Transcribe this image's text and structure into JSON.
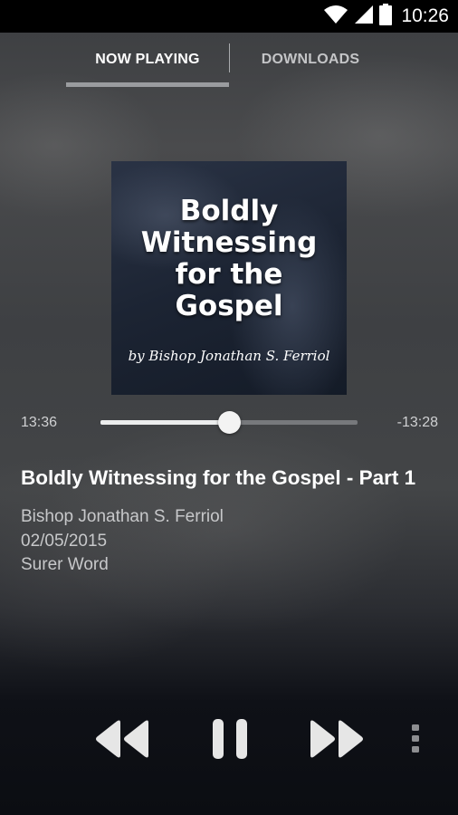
{
  "status_bar": {
    "time": "10:26",
    "icons": [
      "wifi-icon",
      "signal-icon",
      "battery-icon"
    ]
  },
  "tabs": [
    {
      "label": "NOW PLAYING",
      "active": true
    },
    {
      "label": "DOWNLOADS",
      "active": false
    }
  ],
  "artwork": {
    "title": "Boldly\nWitnessing\nfor the\nGospel",
    "author": "by Bishop Jonathan S. Ferriol"
  },
  "player": {
    "elapsed": "13:36",
    "remaining": "-13:28",
    "progress": 0.5
  },
  "track": {
    "title": "Boldly Witnessing for the Gospel - Part 1",
    "speaker": "Bishop Jonathan S. Ferriol",
    "date": "02/05/2015",
    "series": "Surer Word"
  },
  "controls": [
    "rewind-icon",
    "pause-icon",
    "fast-forward-icon",
    "more-vert-icon"
  ],
  "colors": {
    "accent": "#eceded",
    "status_bar": "#000000"
  }
}
